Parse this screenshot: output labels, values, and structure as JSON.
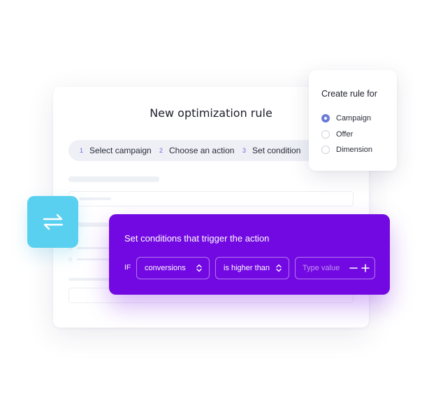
{
  "main_card": {
    "title": "New optimization rule",
    "steps": [
      {
        "number": "1",
        "label": "Select campaign"
      },
      {
        "number": "2",
        "label": "Choose an action"
      },
      {
        "number": "3",
        "label": "Set condition"
      }
    ]
  },
  "popover": {
    "title": "Create rule for",
    "options": [
      {
        "label": "Campaign",
        "selected": true
      },
      {
        "label": "Offer",
        "selected": false
      },
      {
        "label": "Dimension",
        "selected": false
      }
    ]
  },
  "swap_tile": {
    "icon": "swap-arrows-icon"
  },
  "conditions": {
    "title": "Set conditions that trigger the action",
    "if_label": "IF",
    "metric_select": "conversions",
    "operator_select": "is higher than",
    "value_placeholder": "Type value",
    "value": ""
  },
  "colors": {
    "accent_purple": "#7309e2",
    "accent_cyan": "#5ad0f0",
    "radio_selected": "#6b7bd8",
    "stepper_bg": "#eef0f6"
  }
}
